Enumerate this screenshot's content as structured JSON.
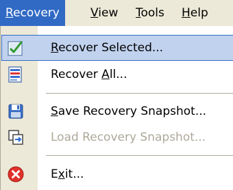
{
  "menubar": {
    "items": [
      {
        "label": "Recovery",
        "mnemonic": "R",
        "rest": "ecovery",
        "active": true
      },
      {
        "label": "View",
        "mnemonic": "V",
        "rest": "iew"
      },
      {
        "label": "Tools",
        "mnemonic": "T",
        "rest": "ools"
      },
      {
        "label": "Help",
        "mnemonic": "H",
        "rest": "elp"
      }
    ]
  },
  "menu": {
    "items": [
      {
        "before": "",
        "mnemonic": "R",
        "after": "ecover Selected...",
        "icon": "recover-selected-icon",
        "state": "highlighted"
      },
      {
        "before": "Recover ",
        "mnemonic": "A",
        "after": "ll...",
        "icon": "recover-all-icon",
        "state": "enabled"
      },
      {
        "before": "",
        "mnemonic": "S",
        "after": "ave Recovery Snapshot...",
        "icon": "save-icon",
        "state": "enabled"
      },
      {
        "label": "Load Recovery Snapshot...",
        "icon": "load-snapshot-icon",
        "state": "disabled"
      },
      {
        "before": "E",
        "mnemonic": "x",
        "after": "it...",
        "icon": "exit-icon",
        "state": "enabled"
      }
    ]
  },
  "colors": {
    "menu_bar": "#ece9d8",
    "selection": "#316ac5",
    "highlight": "#c1d2ee",
    "disabled_text": "#aca899",
    "exit_red": "#e0322b"
  }
}
